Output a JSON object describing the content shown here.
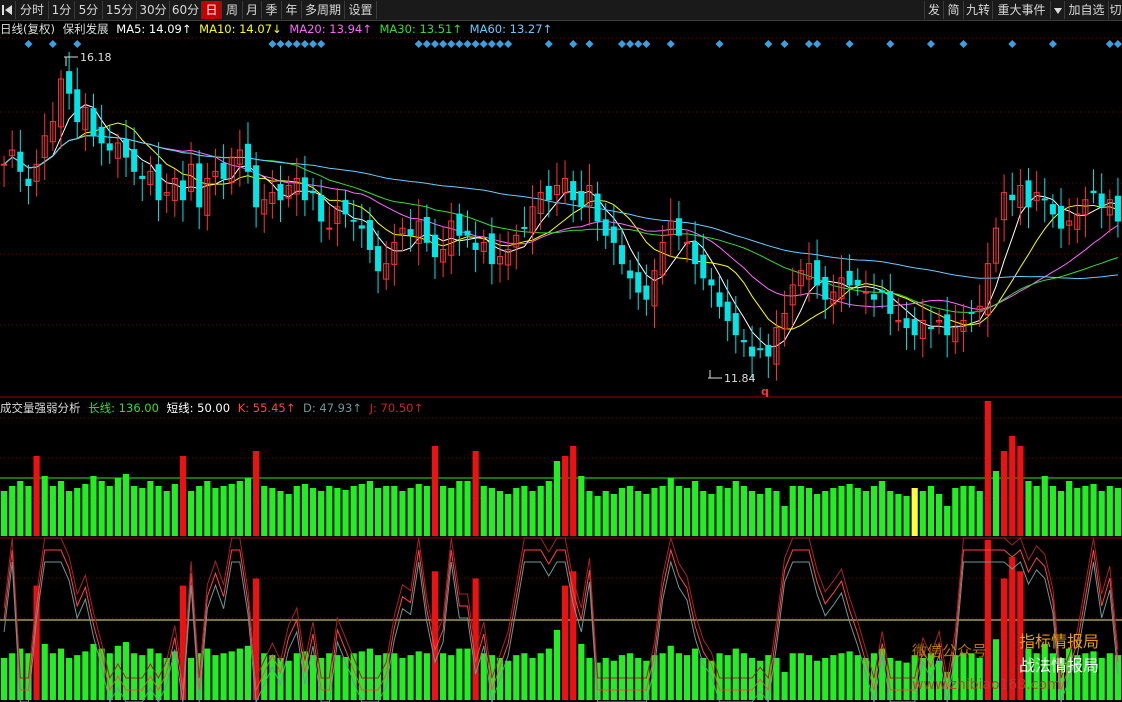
{
  "toolbar": {
    "menu_icon": "back-icon",
    "periods": [
      "分时",
      "1分",
      "5分",
      "15分",
      "30分",
      "60分",
      "日",
      "周",
      "月",
      "季",
      "年",
      "多周期",
      "设置"
    ],
    "active_period": "日",
    "right_buttons": [
      "发",
      "简",
      "九转",
      "重大事件",
      "加自选",
      "切"
    ],
    "dropdown_icon": "caret-down-icon"
  },
  "price_panel": {
    "title": "日线(复权)",
    "stock_name": "保利发展",
    "ma_legend": [
      {
        "label": "MA5: 14.09↑",
        "color": "#ffffff"
      },
      {
        "label": "MA10: 14.07↓",
        "color": "#ffff00"
      },
      {
        "label": "MA20: 13.94↑",
        "color": "#ff66ff"
      },
      {
        "label": "MA30: 13.51↑",
        "color": "#33dd33"
      },
      {
        "label": "MA60: 13.27↑",
        "color": "#66ccff"
      }
    ],
    "high_label": "16.18",
    "low_label": "11.84",
    "marker_q": "q"
  },
  "indicator_panel": {
    "title": "成交量强弱分析",
    "legend": [
      {
        "label": "长线: 136.00",
        "color": "#33dd33"
      },
      {
        "label": "短线: 50.00",
        "color": "#ffffff"
      },
      {
        "label": "K: 55.45↑",
        "color": "#ff4444"
      },
      {
        "label": "D: 47.93↑",
        "color": "#669999"
      },
      {
        "label": "J: 70.50↑",
        "color": "#cc2222"
      }
    ]
  },
  "watermark": {
    "line1": "微信公众号",
    "line2": "指标情报局",
    "line3": "战法情报局",
    "url": "www.zhibiao168.com"
  },
  "colors": {
    "up": "#ff3333",
    "down": "#00e5e5",
    "vol_green": "#22ee22",
    "vol_red": "#ee1111",
    "grid": "#7a0000",
    "diamond": "#3aa0e0"
  },
  "chart_data": {
    "type": "candlestick",
    "price_axis": {
      "min": 11.84,
      "max": 16.18
    },
    "closes": [
      14.7,
      14.9,
      14.6,
      14.4,
      14.7,
      15.1,
      15.3,
      15.9,
      15.7,
      15.3,
      15.5,
      15.1,
      15.0,
      14.9,
      15.0,
      14.8,
      14.6,
      14.5,
      14.6,
      14.2,
      14.3,
      14.5,
      14.2,
      14.7,
      14.1,
      14.5,
      14.6,
      14.5,
      14.8,
      14.9,
      14.6,
      14.1,
      14.2,
      14.3,
      14.2,
      14.4,
      14.5,
      14.2,
      14.3,
      13.9,
      13.8,
      14.1,
      14.0,
      13.9,
      13.8,
      13.5,
      13.2,
      13.3,
      13.6,
      13.8,
      13.7,
      13.9,
      13.6,
      13.4,
      13.5,
      13.9,
      13.7,
      13.7,
      13.5,
      13.6,
      13.3,
      13.4,
      13.5,
      13.7,
      13.8,
      14.1,
      14.3,
      14.2,
      14.4,
      14.5,
      14.2,
      14.1,
      14.4,
      13.9,
      13.7,
      13.6,
      13.3,
      13.1,
      12.9,
      12.8,
      13.2,
      13.6,
      13.9,
      13.7,
      13.6,
      13.3,
      13.1,
      13.0,
      12.7,
      12.5,
      12.3,
      12.2,
      12.0,
      12.1,
      12.0,
      12.4,
      12.6,
      13.0,
      13.2,
      13.3,
      13.0,
      12.8,
      12.9,
      13.1,
      13.0,
      13.0,
      12.9,
      12.8,
      12.9,
      12.6,
      12.5,
      12.4,
      12.3,
      12.5,
      12.4,
      12.5,
      12.3,
      12.4,
      12.5,
      12.6,
      12.7,
      13.3,
      13.8,
      14.3,
      14.2,
      14.4,
      14.1,
      14.3,
      14.2,
      14.0,
      13.8,
      13.9,
      14.0,
      14.2,
      14.3,
      14.1,
      14.2,
      13.9
    ],
    "vol_strength": [
      0.45,
      0.5,
      0.55,
      0.5,
      0.8,
      0.6,
      0.5,
      0.55,
      0.45,
      0.48,
      0.52,
      0.6,
      0.55,
      0.5,
      0.58,
      0.62,
      0.5,
      0.48,
      0.55,
      0.5,
      0.45,
      0.52,
      0.8,
      0.45,
      0.5,
      0.55,
      0.48,
      0.5,
      0.52,
      0.55,
      0.58,
      0.85,
      0.5,
      0.48,
      0.45,
      0.42,
      0.5,
      0.52,
      0.48,
      0.45,
      0.5,
      0.48,
      0.46,
      0.5,
      0.52,
      0.55,
      0.48,
      0.5,
      0.5,
      0.45,
      0.48,
      0.52,
      0.5,
      0.9,
      0.5,
      0.48,
      0.55,
      0.55,
      0.85,
      0.5,
      0.48,
      0.45,
      0.42,
      0.48,
      0.5,
      0.45,
      0.5,
      0.55,
      0.75,
      0.8,
      0.9,
      0.6,
      0.45,
      0.4,
      0.45,
      0.42,
      0.48,
      0.5,
      0.45,
      0.42,
      0.48,
      0.5,
      0.58,
      0.5,
      0.48,
      0.55,
      0.45,
      0.42,
      0.5,
      0.48,
      0.55,
      0.5,
      0.45,
      0.42,
      0.48,
      0.45,
      0.3,
      0.5,
      0.5,
      0.48,
      0.42,
      0.45,
      0.48,
      0.5,
      0.52,
      0.48,
      0.45,
      0.5,
      0.55,
      0.45,
      0.42,
      0.4,
      0.48,
      0.45,
      0.5,
      0.42,
      0.3,
      0.48,
      0.5,
      0.5,
      0.45,
      1.35,
      0.65,
      0.85,
      1.0,
      0.9,
      0.55,
      0.5,
      0.6,
      0.5,
      0.45,
      0.55,
      0.48,
      0.5,
      0.52,
      0.45,
      0.5,
      0.48
    ]
  }
}
